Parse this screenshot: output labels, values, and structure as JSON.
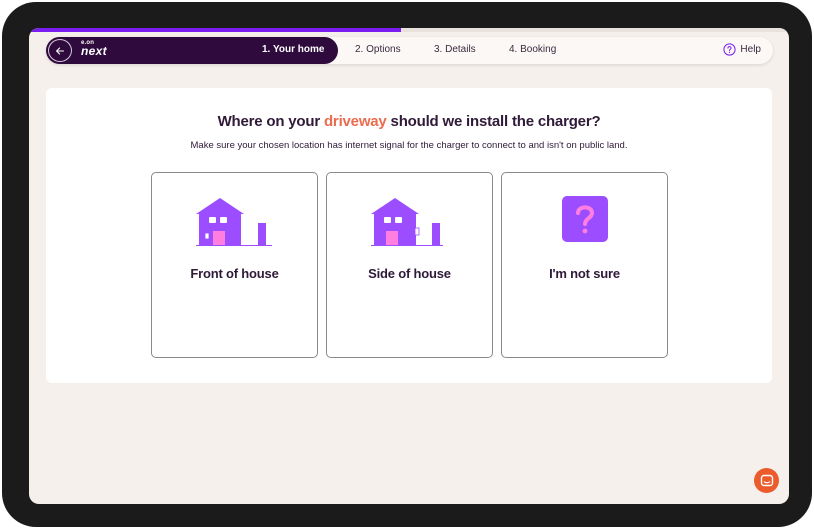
{
  "progress": {
    "fraction": 0.49
  },
  "brand": {
    "eon": "e.on",
    "next": "next"
  },
  "steps": [
    {
      "label": "1. Your home"
    },
    {
      "label": "2. Options"
    },
    {
      "label": "3. Details"
    },
    {
      "label": "4. Booking"
    }
  ],
  "help": {
    "label": "Help"
  },
  "question": {
    "prefix": "Where on your",
    "highlight": "driveway",
    "suffix": "should we install the charger?",
    "subtitle": "Make sure your chosen location has internet signal for the charger to connect to and isn't on public land."
  },
  "options": [
    {
      "label": "Front of house",
      "icon": "house-front-charger-icon"
    },
    {
      "label": "Side of house",
      "icon": "house-side-charger-icon"
    },
    {
      "label": "I'm not sure",
      "icon": "question-mark-icon"
    }
  ],
  "colors": {
    "brand_dark": "#2f0a3d",
    "progress": "#7a1df0",
    "accent": "#ec6c4f",
    "icon_purple": "#9b4dff",
    "icon_pink": "#ff7ee0",
    "chat": "#ec5b2c",
    "background": "#f5f0eb"
  }
}
